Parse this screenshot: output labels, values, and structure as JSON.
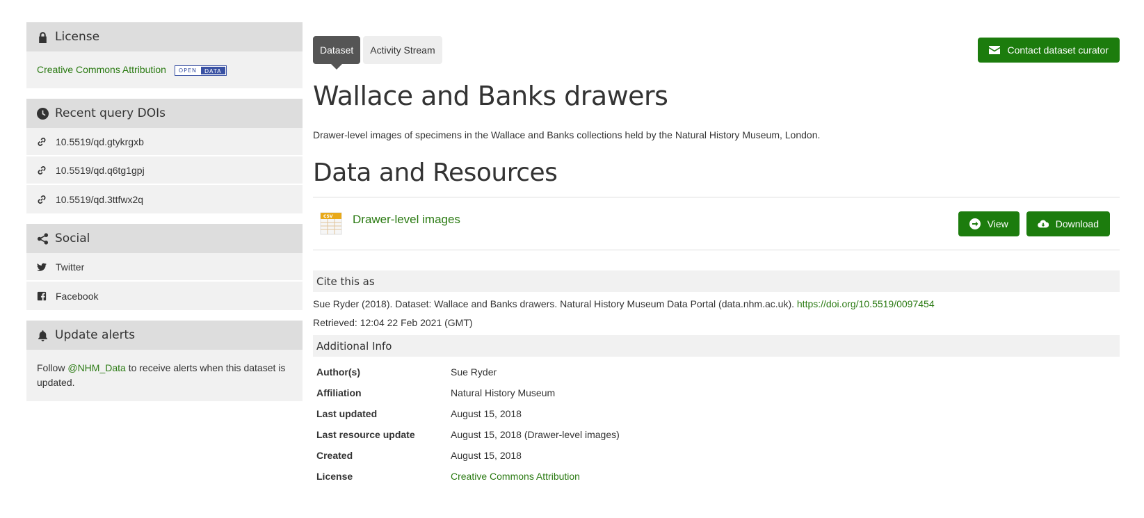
{
  "sidebar": {
    "license": {
      "heading": "License",
      "link": "Creative Commons Attribution",
      "badge_open": "OPEN",
      "badge_data": "DATA"
    },
    "dois": {
      "heading": "Recent query DOIs",
      "items": [
        "10.5519/qd.gtykrgxb",
        "10.5519/qd.q6tg1gpj",
        "10.5519/qd.3ttfwx2q"
      ]
    },
    "social": {
      "heading": "Social",
      "twitter": "Twitter",
      "facebook": "Facebook"
    },
    "alerts": {
      "heading": "Update alerts",
      "text_before": "Follow ",
      "handle": "@NHM_Data",
      "text_after": " to receive alerts when this dataset is updated."
    }
  },
  "main": {
    "tabs": [
      {
        "label": "Dataset",
        "active": true
      },
      {
        "label": "Activity Stream",
        "active": false
      }
    ],
    "contact_label": "Contact dataset curator",
    "title": "Wallace and Banks drawers",
    "description": "Drawer-level images of specimens in the Wallace and Banks collections held by the Natural History Museum, London.",
    "resources_heading": "Data and Resources",
    "resource": {
      "name": "Drawer-level images",
      "format": "CSV",
      "view_label": "View",
      "download_label": "Download"
    },
    "cite": {
      "heading": "Cite this as",
      "text": "Sue Ryder (2018). Dataset: Wallace and Banks drawers. Natural History Museum Data Portal (data.nhm.ac.uk). ",
      "doi_link": "https://doi.org/10.5519/0097454",
      "retrieved": "Retrieved: 12:04 22 Feb 2021 (GMT)"
    },
    "additional": {
      "heading": "Additional Info",
      "rows": [
        {
          "key": "Author(s)",
          "value": "Sue Ryder"
        },
        {
          "key": "Affiliation",
          "value": "Natural History Museum"
        },
        {
          "key": "Last updated",
          "value": "August 15, 2018"
        },
        {
          "key": "Last resource update",
          "value": "August 15, 2018 (Drawer-level images)"
        },
        {
          "key": "Created",
          "value": "August 15, 2018"
        },
        {
          "key": "License",
          "value": "Creative Commons Attribution"
        }
      ]
    }
  },
  "colors": {
    "accent_green": "#1c7c0d",
    "link_green": "#2a7a12",
    "panel_header": "#dddddd",
    "panel_body": "#f1f1f1"
  }
}
